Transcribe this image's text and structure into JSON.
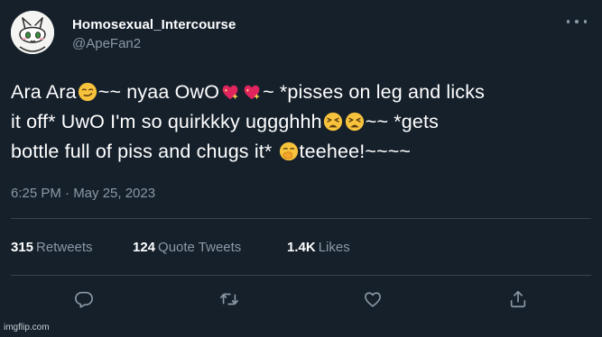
{
  "tweet": {
    "author": {
      "display_name": "Homosexual_Intercourse",
      "handle": "@ApeFan2"
    },
    "text_segments": {
      "s1": "Ara Ara",
      "s2": "~~ nyaa OwO",
      "s3": "~ *pisses on leg and licks",
      "s4": "it off* UwO I'm so quirkkky uggghhh",
      "s5": "~~ *gets",
      "s6": "bottle full of piss and chugs it*",
      "s7": "teehee!~~~~"
    },
    "emojis": [
      "smirking-face",
      "sparkling-heart",
      "sparkling-heart",
      "tired-face",
      "tired-face",
      "face-with-hand-over-mouth"
    ],
    "timestamp": "6:25 PM · May 25, 2023",
    "stats": {
      "retweets_count": "315",
      "retweets_label": "Retweets",
      "quotes_count": "124",
      "quotes_label": "Quote Tweets",
      "likes_count": "1.4K",
      "likes_label": "Likes"
    },
    "actions": [
      "reply-icon",
      "retweet-icon",
      "like-icon",
      "share-icon"
    ]
  },
  "colors": {
    "background": "#15202b",
    "text": "#ffffff",
    "secondary_text": "#8b98a5",
    "divider": "#38444d"
  },
  "watermark": "imgflip.com"
}
